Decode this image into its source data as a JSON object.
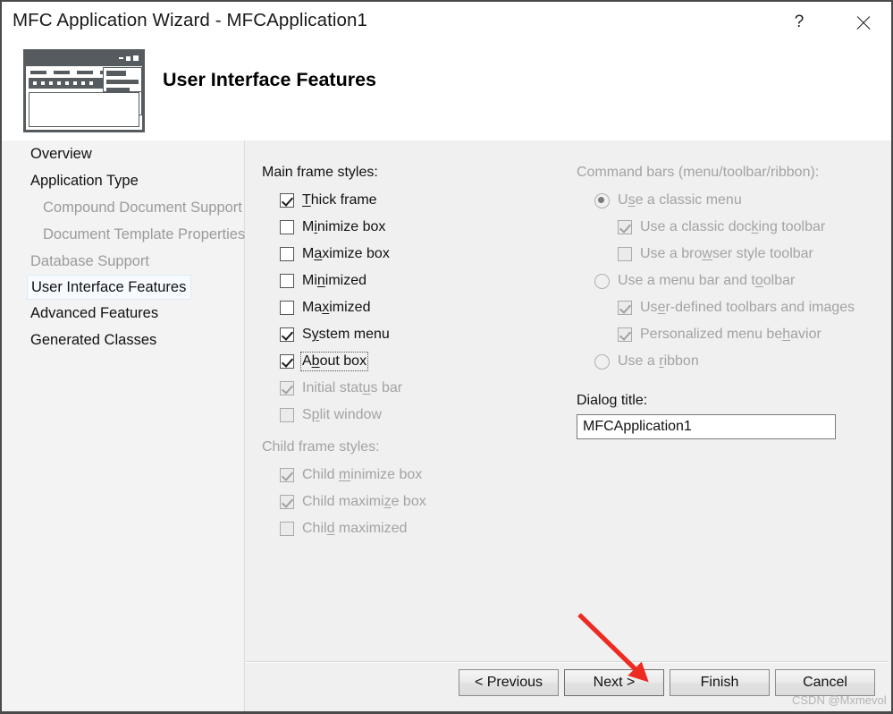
{
  "window": {
    "title": "MFC Application Wizard - MFCApplication1",
    "help_button": "?",
    "close_button": "✕"
  },
  "header": {
    "page_title": "User Interface Features",
    "icon_name": "app-window-preview-icon"
  },
  "sidebar": {
    "items": [
      {
        "label": "Overview",
        "state": "enabled",
        "indent": false
      },
      {
        "label": "Application Type",
        "state": "enabled",
        "indent": false
      },
      {
        "label": "Compound Document Support",
        "state": "disabled",
        "indent": true
      },
      {
        "label": "Document Template Properties",
        "state": "disabled",
        "indent": true
      },
      {
        "label": "Database Support",
        "state": "disabled",
        "indent": false
      },
      {
        "label": "User Interface Features",
        "state": "selected",
        "indent": false
      },
      {
        "label": "Advanced Features",
        "state": "enabled",
        "indent": false
      },
      {
        "label": "Generated Classes",
        "state": "enabled",
        "indent": false
      }
    ]
  },
  "main_frame_styles": {
    "group_label": "Main frame styles:",
    "options": [
      {
        "label": "Thick frame",
        "mnemonic": "T",
        "checked": true,
        "disabled": false,
        "focused": false
      },
      {
        "label": "Minimize box",
        "mnemonic": "i",
        "checked": false,
        "disabled": false,
        "focused": false
      },
      {
        "label": "Maximize box",
        "mnemonic": "a",
        "checked": false,
        "disabled": false,
        "focused": false
      },
      {
        "label": "Minimized",
        "mnemonic": "n",
        "checked": false,
        "disabled": false,
        "focused": false
      },
      {
        "label": "Maximized",
        "mnemonic": "x",
        "checked": false,
        "disabled": false,
        "focused": false
      },
      {
        "label": "System menu",
        "mnemonic": "y",
        "checked": true,
        "disabled": false,
        "focused": false
      },
      {
        "label": "About box",
        "mnemonic": "b",
        "checked": true,
        "disabled": false,
        "focused": true
      },
      {
        "label": "Initial status bar",
        "mnemonic": "u",
        "checked": true,
        "disabled": true,
        "focused": false
      },
      {
        "label": "Split window",
        "mnemonic": "p",
        "checked": false,
        "disabled": true,
        "focused": false
      }
    ]
  },
  "child_frame_styles": {
    "group_label": "Child frame styles:",
    "group_disabled": true,
    "options": [
      {
        "label": "Child minimize box",
        "mnemonic": "m",
        "checked": true,
        "disabled": true
      },
      {
        "label": "Child maximize box",
        "mnemonic": "z",
        "checked": true,
        "disabled": true
      },
      {
        "label": "Child maximized",
        "mnemonic": "d",
        "checked": false,
        "disabled": true
      }
    ]
  },
  "command_bars": {
    "group_label": "Command bars (menu/toolbar/ribbon):",
    "group_disabled": true,
    "radios": [
      {
        "label": "Use a classic menu",
        "mnemonic": "s",
        "selected": true,
        "disabled": true
      },
      {
        "label": "Use a menu bar and toolbar",
        "mnemonic": "o",
        "selected": false,
        "disabled": true
      },
      {
        "label": "Use a ribbon",
        "mnemonic": "r",
        "selected": false,
        "disabled": true
      }
    ],
    "classic_menu_children": [
      {
        "label": "Use a classic docking toolbar",
        "mnemonic": "k",
        "checked": true,
        "disabled": true
      },
      {
        "label": "Use a browser style toolbar",
        "mnemonic": "w",
        "checked": false,
        "disabled": true
      }
    ],
    "menubar_children": [
      {
        "label": "User-defined toolbars and images",
        "mnemonic": "e",
        "checked": true,
        "disabled": true
      },
      {
        "label": "Personalized menu behavior",
        "mnemonic": "h",
        "checked": true,
        "disabled": true
      }
    ]
  },
  "dialog_title": {
    "label": "Dialog title:",
    "mnemonic": "g",
    "value": "MFCApplication1",
    "placeholder": ""
  },
  "footer": {
    "buttons": [
      {
        "label": "< Previous",
        "default": false
      },
      {
        "label": "Next >",
        "default": true
      },
      {
        "label": "Finish",
        "default": false
      },
      {
        "label": "Cancel",
        "default": false
      }
    ],
    "watermark": "CSDN @Mxmevol"
  },
  "annotation": {
    "type": "arrow",
    "color": "#ee2b22",
    "points_to": "Next >"
  }
}
